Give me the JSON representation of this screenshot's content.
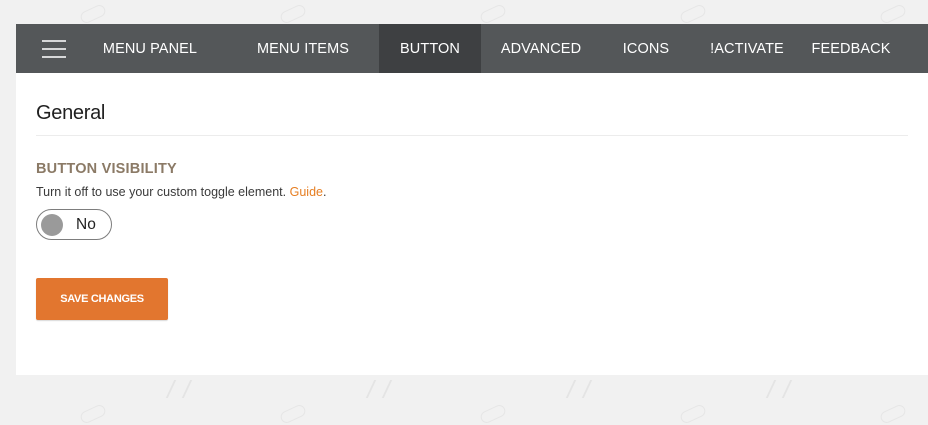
{
  "navbar": {
    "menu_icon": "hamburger-icon",
    "tabs": [
      {
        "id": "menu-panel",
        "label": "MENU PANEL"
      },
      {
        "id": "menu-items",
        "label": "MENU ITEMS"
      },
      {
        "id": "button",
        "label": "BUTTON",
        "active": true
      },
      {
        "id": "advanced",
        "label": "ADVANCED"
      },
      {
        "id": "icons",
        "label": "ICONS"
      },
      {
        "id": "activate",
        "label": "!ACTIVATE"
      },
      {
        "id": "feedback",
        "label": "FEEDBACK"
      }
    ]
  },
  "section": {
    "title": "General"
  },
  "button_visibility": {
    "label": "BUTTON VISIBILITY",
    "description": "Turn it off to use your custom toggle element.",
    "guide_link": "Guide",
    "description_end": ".",
    "toggle_state": "No"
  },
  "actions": {
    "save_label": "SAVE CHANGES"
  },
  "colors": {
    "navbar_bg": "#545759",
    "active_tab_bg": "#3e4042",
    "accent_orange": "#e2762f",
    "label_brown": "#8b7a66"
  }
}
